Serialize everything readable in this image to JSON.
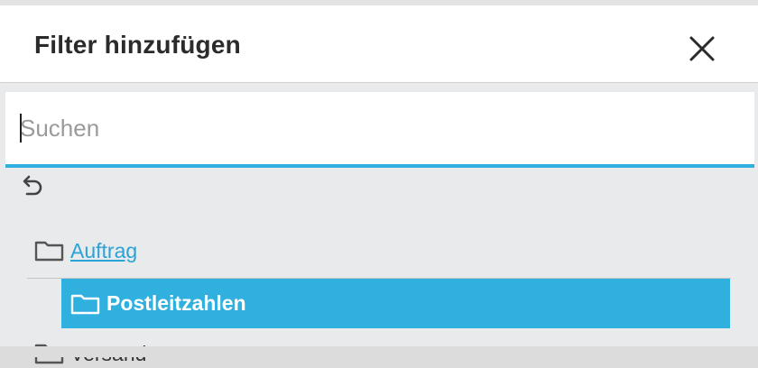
{
  "dialog": {
    "title": "Filter hinzufügen",
    "close_icon": "close-icon"
  },
  "search": {
    "placeholder": "Suchen",
    "value": ""
  },
  "navigation": {
    "back_icon": "undo-arrow-icon"
  },
  "tree": {
    "items": [
      {
        "label": "Auftrag",
        "icon": "folder-icon",
        "state": "link"
      },
      {
        "label": "Postleitzahlen",
        "icon": "folder-icon",
        "state": "selected"
      },
      {
        "label": "Versand",
        "icon": "folder-icon",
        "state": "normal"
      }
    ]
  },
  "colors": {
    "accent": "#2fb0df",
    "link": "#2aa3d6",
    "panel_bg": "#e9eaeb",
    "header_bg": "#ffffff"
  }
}
